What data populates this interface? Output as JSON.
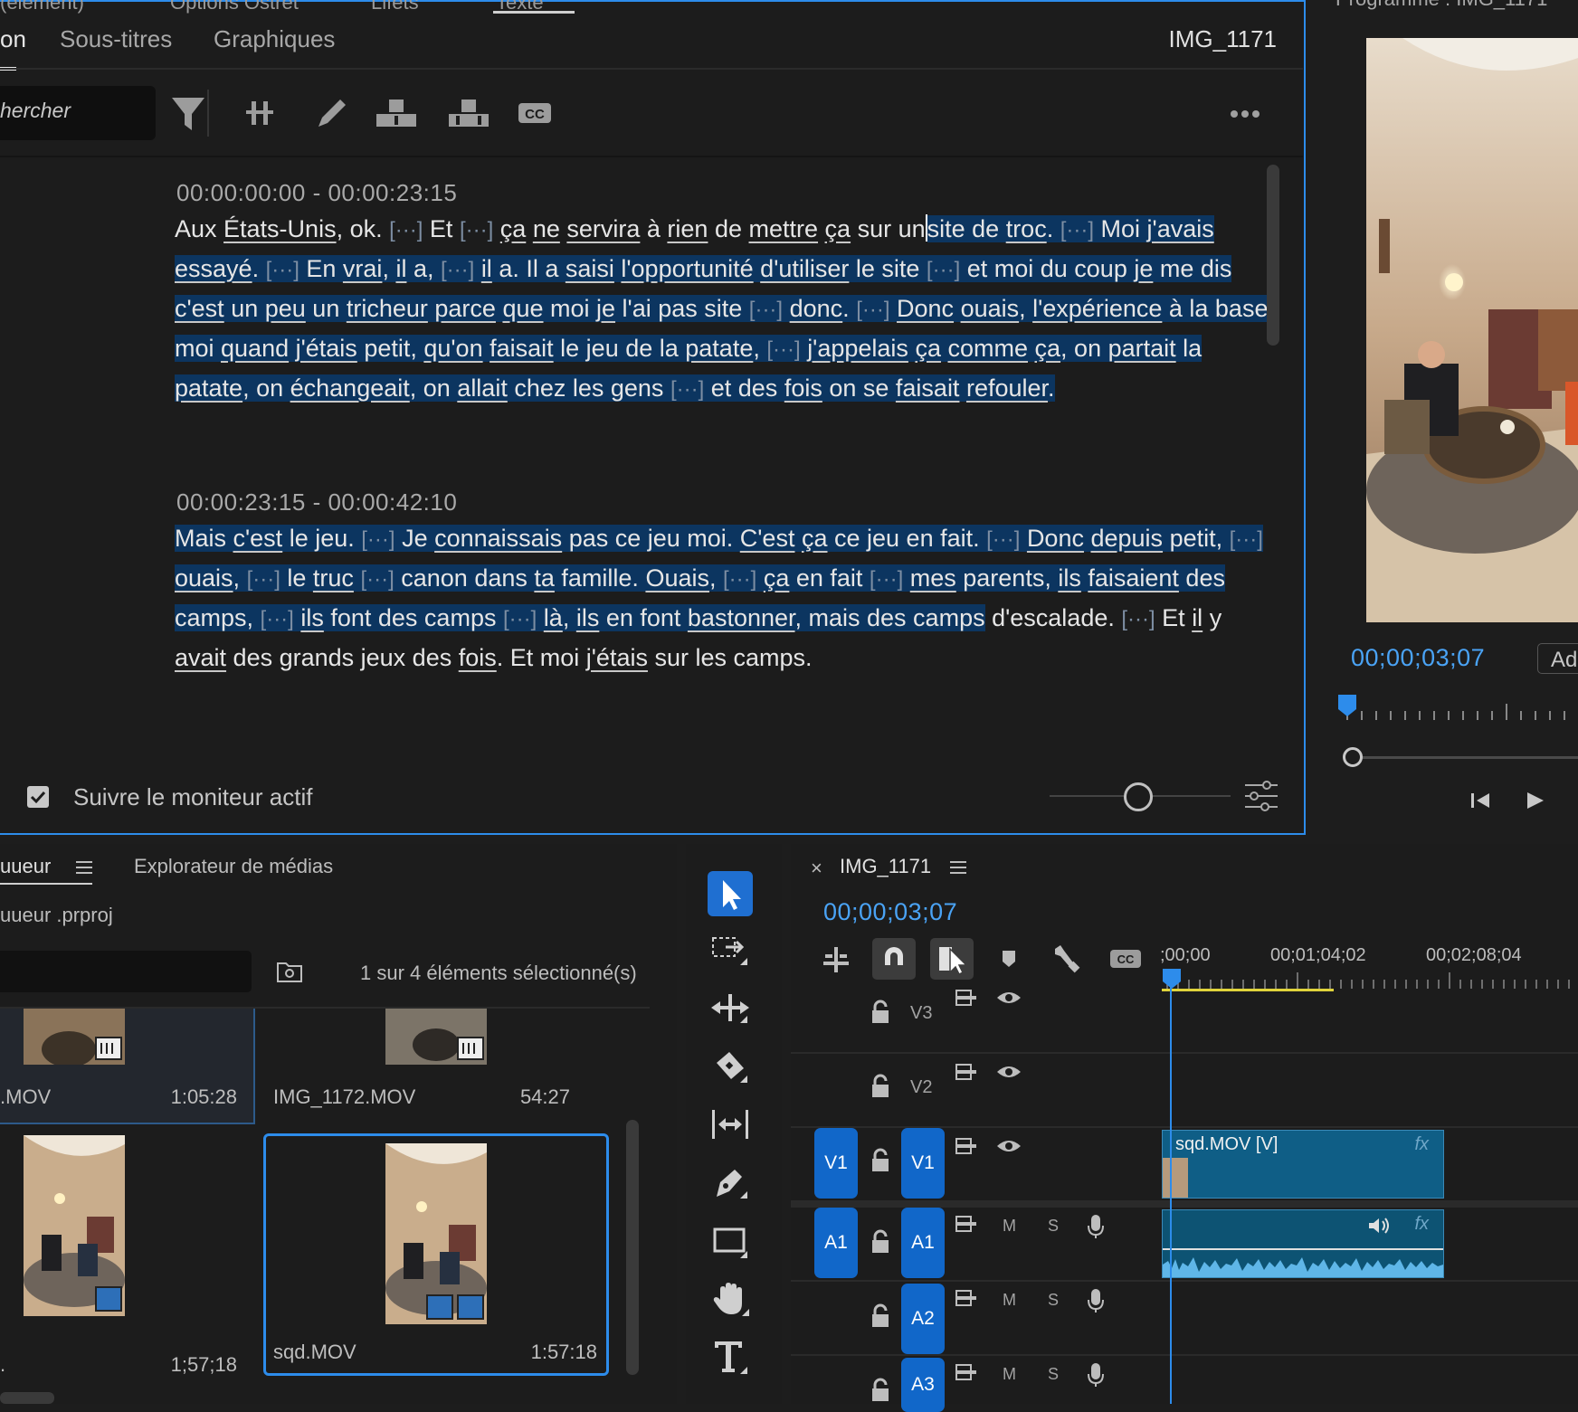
{
  "text_panel": {
    "top_tabs": [
      "(élément)",
      "Options Ostret",
      "Lifets",
      "Texte"
    ],
    "sub_tabs": [
      {
        "label": "on",
        "active": true
      },
      {
        "label": "Sous-titres",
        "active": false
      },
      {
        "label": "Graphiques",
        "active": false
      }
    ],
    "clip_name": "IMG_1171",
    "search_placeholder": "hercher",
    "tools": [
      "filter-icon",
      "split-icon",
      "edit-pencil-icon",
      "insert-icon",
      "overwrite-icon",
      "cc-icon",
      "more-icon"
    ],
    "segments": [
      {
        "timecode": "00:00:00:00 - 00:00:23:15",
        "text": "Aux États-Unis, ok. [···] Et [···] ça ne servira à rien de mettre ça sur un site de troc. [···] Moi j'avais essayé. [···] En vrai, il a, [···] il a. Il a saisi l'opportunité d'utiliser le site [···] et moi du coup je me dis c'est un peu un tricheur parce que moi je l'ai pas site [···] donc. [···] Donc ouais, l'expérience à la base, moi quand j'étais petit, qu'on faisait le jeu de la patate, [···] j'appelais ça comme ça, on partait la patate, on échangeait, on allait chez les gens [···] et des fois on se faisait refouler."
      },
      {
        "timecode": "00:00:23:15 - 00:00:42:10",
        "text": "Mais c'est le jeu. [···] Je connaissais pas ce jeu moi. C'est ça ce jeu en fait. [···] Donc depuis petit, [···] ouais, [···] le truc [···] canon dans ta famille. Ouais, [···] ça en fait [···] mes parents, ils faisaient des camps, [···] ils font des camps [···] là, ils en font bastonner, mais des camps d'escalade. [···] Et il y avait des grands jeux des fois. Et moi j'étais sur les camps."
      }
    ],
    "follow_monitor_label": "Suivre le moniteur actif",
    "follow_monitor_checked": true
  },
  "program_monitor": {
    "title": "Programme : IMG_1171",
    "timecode": "00;00;03;07",
    "fit_label": "Ad"
  },
  "project_panel": {
    "tabs": [
      "uueur",
      "Explorateur de médias"
    ],
    "project_file": "uueur .prproj",
    "selection_status": "1 sur 4 éléments sélectionné(s)",
    "items": [
      {
        "name": ".MOV",
        "duration": "1:05:28"
      },
      {
        "name": "IMG_1172.MOV",
        "duration": "54:27"
      },
      {
        "name": ".",
        "duration": "1;57;18"
      },
      {
        "name": "sqd.MOV",
        "duration": "1:57:18"
      }
    ]
  },
  "timeline": {
    "sequence_name": "IMG_1171",
    "close_glyph": "×",
    "timecode": "00;00;03;07",
    "ruler_labels": [
      ";00;00",
      "00;01;04;02",
      "00;02;08;04"
    ],
    "video_tracks": [
      {
        "src": "",
        "target": "V3"
      },
      {
        "src": "",
        "target": "V2"
      },
      {
        "src": "V1",
        "target": "V1"
      }
    ],
    "audio_tracks": [
      {
        "src": "A1",
        "target": "A1"
      },
      {
        "src": "",
        "target": "A2"
      },
      {
        "src": "",
        "target": "A3"
      }
    ],
    "mute_label": "M",
    "solo_label": "S",
    "fx_label": "fx",
    "clip_label": "sqd.MOV [V]"
  },
  "colors": {
    "accent": "#2d8ceb",
    "track_button": "#1167c9",
    "selection": "#0c3560",
    "clip_video": "#0f5e86",
    "clip_audio": "#0d5373",
    "timecode": "#4aa3f5",
    "work_area": "#e0d33b"
  }
}
